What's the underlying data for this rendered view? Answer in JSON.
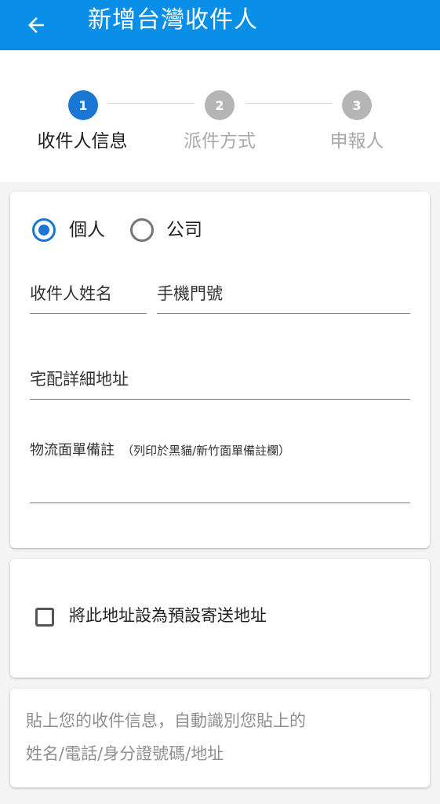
{
  "appbar": {
    "title": "新增台灣收件人",
    "back_icon": "arrow-left-icon",
    "color": "#0a8fe8"
  },
  "stepper": {
    "steps": [
      {
        "number": "1",
        "label": "收件人信息",
        "active": true
      },
      {
        "number": "2",
        "label": "派件方式",
        "active": false
      },
      {
        "number": "3",
        "label": "申報人",
        "active": false
      }
    ],
    "active_color": "#1976d2",
    "inactive_color": "#b5b5b5"
  },
  "form": {
    "type_options": [
      {
        "label": "個人",
        "selected": true
      },
      {
        "label": "公司",
        "selected": false
      }
    ],
    "name_placeholder": "收件人姓名",
    "phone_placeholder": "手機門號",
    "address_placeholder": "宅配詳細地址",
    "note_label": "物流面單備註",
    "note_hint": "（列印於黑貓/新竹面單備註欄）"
  },
  "default_address": {
    "label": "將此地址設為預設寄送地址",
    "checked": false
  },
  "paste": {
    "placeholder_line1": "貼上您的收件信息，自動識別您貼上的",
    "placeholder_line2": "姓名/電話/身分證號碼/地址"
  }
}
